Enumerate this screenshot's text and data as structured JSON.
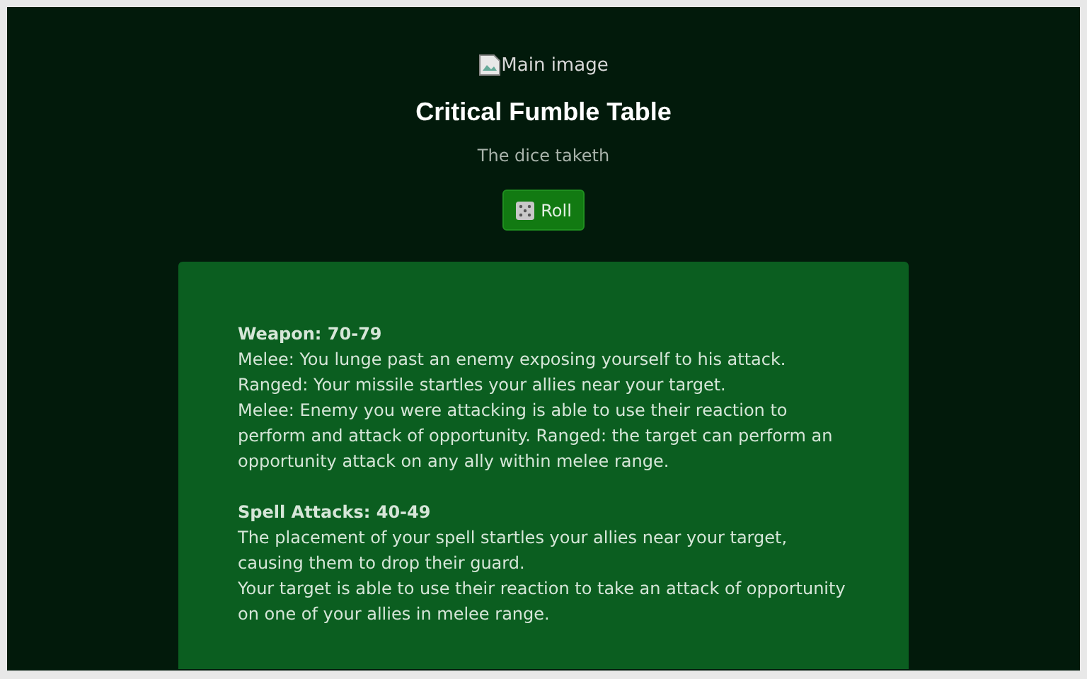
{
  "image": {
    "alt": "Main image"
  },
  "title": "Critical Fumble Table",
  "subtitle": "The dice taketh",
  "roll_button": {
    "label": "Roll"
  },
  "results": [
    {
      "heading": "Weapon: 70-79",
      "paragraphs": [
        "Melee: You lunge past an enemy exposing yourself to his attack.",
        "Ranged: Your missile startles your allies near your target.",
        "Melee: Enemy you were attacking is able to use their reaction to perform and attack of opportunity. Ranged: the target can perform an opportunity attack on any ally within melee range."
      ]
    },
    {
      "heading": "Spell Attacks: 40-49",
      "paragraphs": [
        "The placement of your spell startles your allies near your target, causing them to drop their guard.",
        "Your target is able to use their reaction to take an attack of opportunity on one of your allies in melee range."
      ]
    }
  ]
}
